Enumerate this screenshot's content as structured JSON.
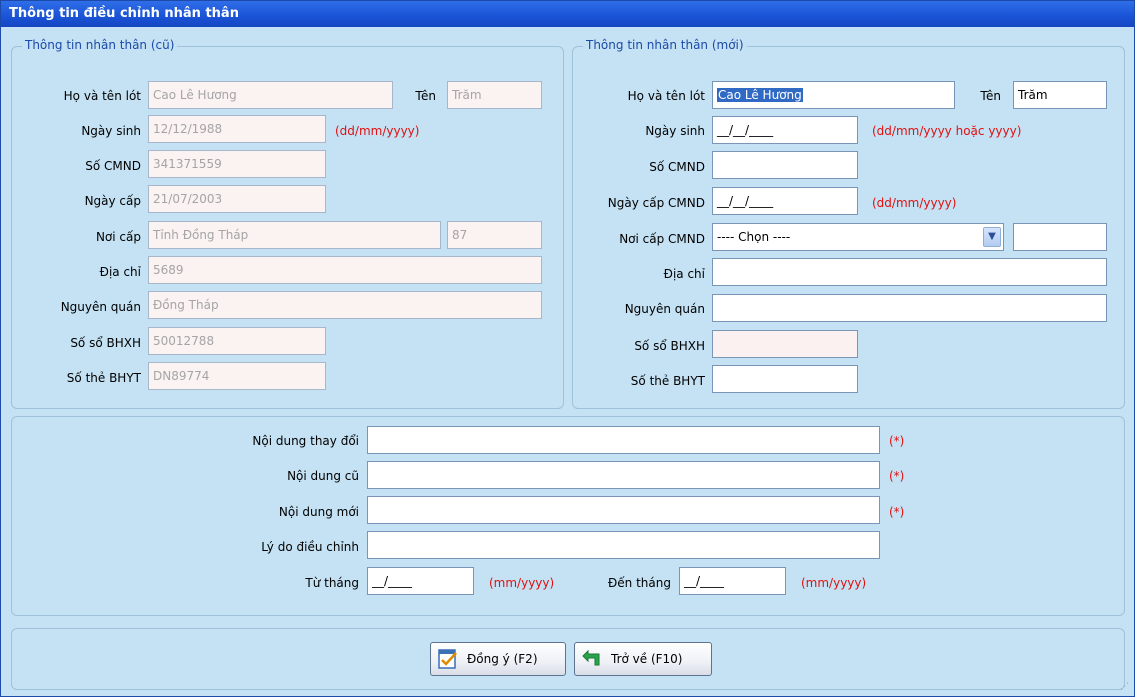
{
  "window": {
    "title": "Thông tin điều chỉnh nhân thân"
  },
  "old": {
    "legend": "Thông tin nhân thân (cũ)",
    "ho_ten_lot_label": "Họ và tên lót",
    "ho_ten_lot": "Cao Lê Hương",
    "ten_label": "Tên",
    "ten": "Trăm",
    "ngay_sinh_label": "Ngày sinh",
    "ngay_sinh": "12/12/1988",
    "ngay_sinh_hint": "(dd/mm/yyyy)",
    "cmnd_label": "Số CMND",
    "cmnd": "341371559",
    "ngay_cap_label": "Ngày cấp",
    "ngay_cap": "21/07/2003",
    "noi_cap_label": "Nơi cấp",
    "noi_cap": "Tỉnh Đồng Tháp",
    "noi_cap_code": "87",
    "dia_chi_label": "Địa chỉ",
    "dia_chi": "5689",
    "nguyen_quan_label": "Nguyên quán",
    "nguyen_quan": "Đồng Tháp",
    "so_bhxh_label": "Số sổ BHXH",
    "so_bhxh": "50012788",
    "so_bhyt_label": "Số thẻ BHYT",
    "so_bhyt": "DN89774"
  },
  "new": {
    "legend": "Thông tin nhân thân (mới)",
    "ho_ten_lot_label": "Họ và tên lót",
    "ho_ten_lot": "Cao Lê Hương",
    "ten_label": "Tên",
    "ten": "Trăm",
    "ngay_sinh_label": "Ngày sinh",
    "ngay_sinh": "__/__/____",
    "ngay_sinh_hint": "(dd/mm/yyyy hoặc yyyy)",
    "cmnd_label": "Số CMND",
    "cmnd": "",
    "ngay_cap_label": "Ngày cấp CMND",
    "ngay_cap": "__/__/____",
    "ngay_cap_hint": "(dd/mm/yyyy)",
    "noi_cap_label": "Nơi cấp CMND",
    "noi_cap": "---- Chọn ----",
    "noi_cap_code": "",
    "dia_chi_label": "Địa chỉ",
    "dia_chi": "",
    "nguyen_quan_label": "Nguyên quán",
    "nguyen_quan": "",
    "so_bhxh_label": "Số sổ BHXH",
    "so_bhxh": "",
    "so_bhyt_label": "Số thẻ BHYT",
    "so_bhyt": ""
  },
  "change": {
    "noi_dung_thay_doi_label": "Nội dung thay đổi",
    "noi_dung_cu_label": "Nội dung cũ",
    "noi_dung_moi_label": "Nội dung mới",
    "ly_do_label": "Lý do điều chỉnh",
    "required_mark": "(*)",
    "tu_thang_label": "Từ tháng",
    "tu_thang": "__/____",
    "tu_thang_hint": "(mm/yyyy)",
    "den_thang_label": "Đến tháng",
    "den_thang": "__/____",
    "den_thang_hint": "(mm/yyyy)"
  },
  "buttons": {
    "ok_label": "Đồng ý (F2)",
    "back_label": "Trở về (F10)"
  },
  "colors": {
    "title_bar": "#1a53d6",
    "panel_bg": "#c4e2f4",
    "hint_red": "#e01010",
    "legend_blue": "#1c4aa8"
  }
}
